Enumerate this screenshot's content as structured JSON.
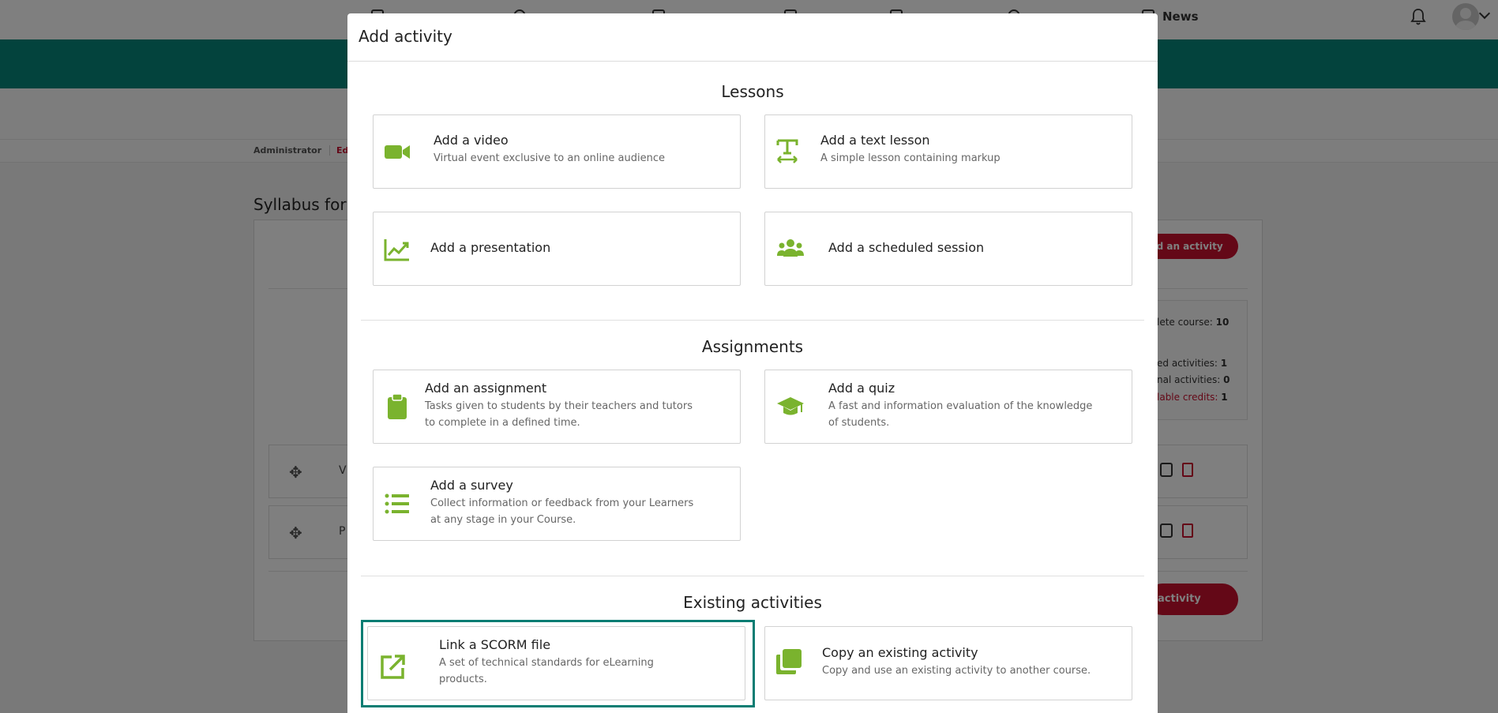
{
  "topnav": {
    "news_label": "News"
  },
  "breadcrumb": {
    "item1": "Administrator",
    "item2": "Edu"
  },
  "syllabus": {
    "title": "Syllabus for:",
    "add_button_top": "dd an activity",
    "add_button_bottom": "activity",
    "stats": {
      "complete_label": "lete course:",
      "complete_value": "10",
      "required_label": "ed activities:",
      "required_value": "1",
      "optional_label": "nal activities:",
      "optional_value": "0",
      "credits_label": "lable credits:",
      "credits_value": "1"
    },
    "rows": [
      {
        "letter": "V"
      },
      {
        "letter": "P"
      }
    ]
  },
  "modal": {
    "title": "Add activity",
    "sections": {
      "lessons": "Lessons",
      "assignments": "Assignments",
      "existing": "Existing activities"
    },
    "cards": {
      "video": {
        "title": "Add a video",
        "desc": "Virtual event exclusive to an online audience",
        "icon": "video-camera-icon"
      },
      "text_lesson": {
        "title": "Add a text lesson",
        "desc": "A simple lesson containing markup",
        "icon": "text-width-icon"
      },
      "presentation": {
        "title": "Add a presentation",
        "icon": "chart-line-icon"
      },
      "scheduled_session": {
        "title": "Add a scheduled session",
        "icon": "users-icon"
      },
      "assignment": {
        "title": "Add an assignment",
        "desc1": "Tasks given to students by their teachers and tutors",
        "desc2": "to complete in a defined time.",
        "icon": "clipboard-icon"
      },
      "quiz": {
        "title": "Add a quiz",
        "desc1": "A fast and information evaluation of the knowledge",
        "desc2": "of students.",
        "icon": "graduation-cap-icon"
      },
      "survey": {
        "title": "Add a survey",
        "desc1": "Collect information or feedback from your Learners",
        "desc2": "at any stage in your Course.",
        "icon": "list-icon"
      },
      "scorm": {
        "title": "Link a SCORM file",
        "desc1": "A set of technical standards for eLearning",
        "desc2": "products.",
        "icon": "external-link-icon"
      },
      "copy": {
        "title": "Copy an existing activity",
        "desc": "Copy and use an existing activity to another course.",
        "icon": "copy-icon"
      }
    }
  },
  "colors": {
    "accent_green": "#7ab32e",
    "teal": "#07877a",
    "brand_red": "#c8102e"
  }
}
